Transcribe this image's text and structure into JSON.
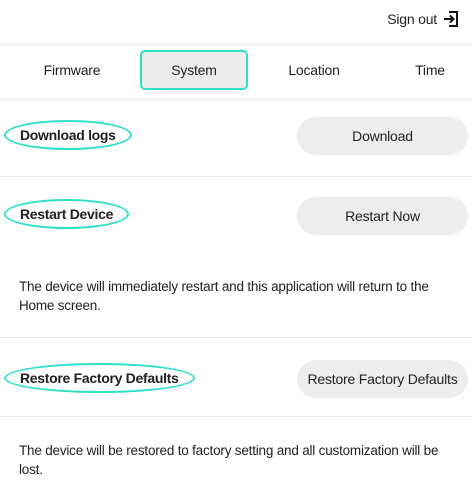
{
  "header": {
    "signout_label": "Sign out",
    "signout_icon": "sign-out-icon"
  },
  "tabs": [
    {
      "label": "Firmware",
      "selected": false
    },
    {
      "label": "System",
      "selected": true
    },
    {
      "label": "Location",
      "selected": false
    },
    {
      "label": "Time",
      "selected": false
    }
  ],
  "rows": {
    "download": {
      "label": "Download logs",
      "button": "Download"
    },
    "restart": {
      "label": "Restart Device",
      "button": "Restart Now",
      "description": "The device will immediately restart and this application will return to the Home screen."
    },
    "restore": {
      "label": "Restore Factory Defaults",
      "button": "Restore Factory Defaults",
      "description": "The device will be restored to factory setting and all customization will be lost."
    }
  },
  "colors": {
    "highlight": "#2fe0c9",
    "button_bg": "#ededed"
  }
}
